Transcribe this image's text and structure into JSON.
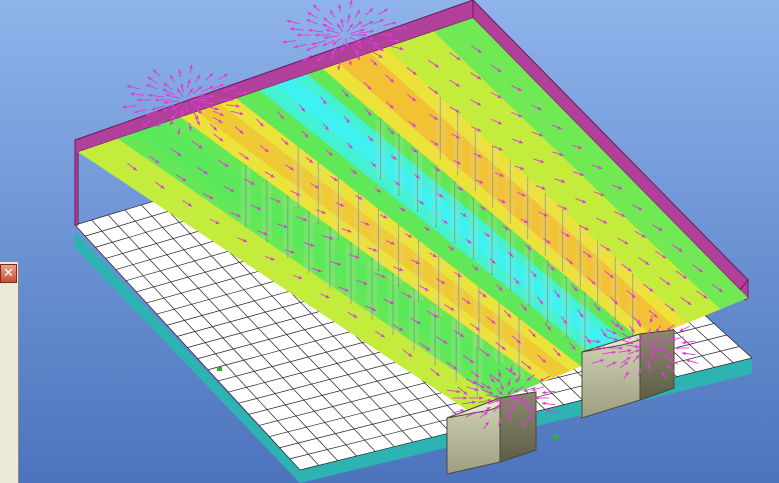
{
  "window": {
    "close_glyph": "✕"
  },
  "scene": {
    "floor_color": "#ffffff",
    "floor_grid_color": "#222222",
    "base_color": "#2eb3b3",
    "wall_color": "#b0409a",
    "wall_edge_color": "#6a1a5e",
    "rack_color": "#d8d8c0",
    "cooling_unit_color": "#c9c9a8",
    "vector_color": "#e03ad8",
    "heatmap_colors": [
      "#3df2f0",
      "#5be85a",
      "#c4ec3c",
      "#f2e13a",
      "#f4b733"
    ]
  },
  "icons": {
    "close": "close-icon"
  }
}
